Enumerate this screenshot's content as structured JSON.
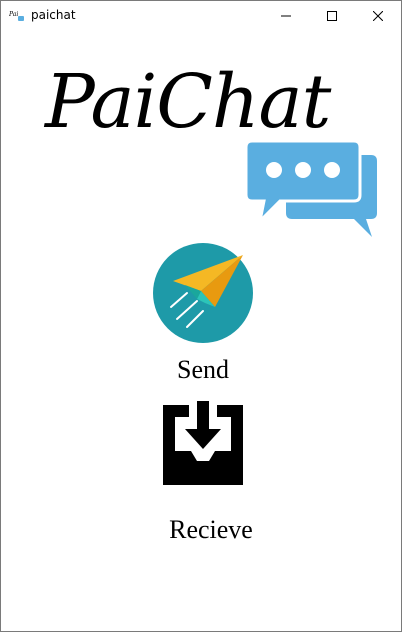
{
  "window": {
    "title": "paichat",
    "app_icon_text": "PaiChat"
  },
  "logo": {
    "text": "PaiChat",
    "bubble_color": "#5aaee0"
  },
  "actions": {
    "send_label": "Send",
    "receive_label": "Recieve"
  },
  "colors": {
    "send_circle": "#1e9aa8",
    "send_plane_primary": "#f5b824",
    "send_plane_secondary": "#2cc4b8",
    "receive_icon": "#000000"
  }
}
